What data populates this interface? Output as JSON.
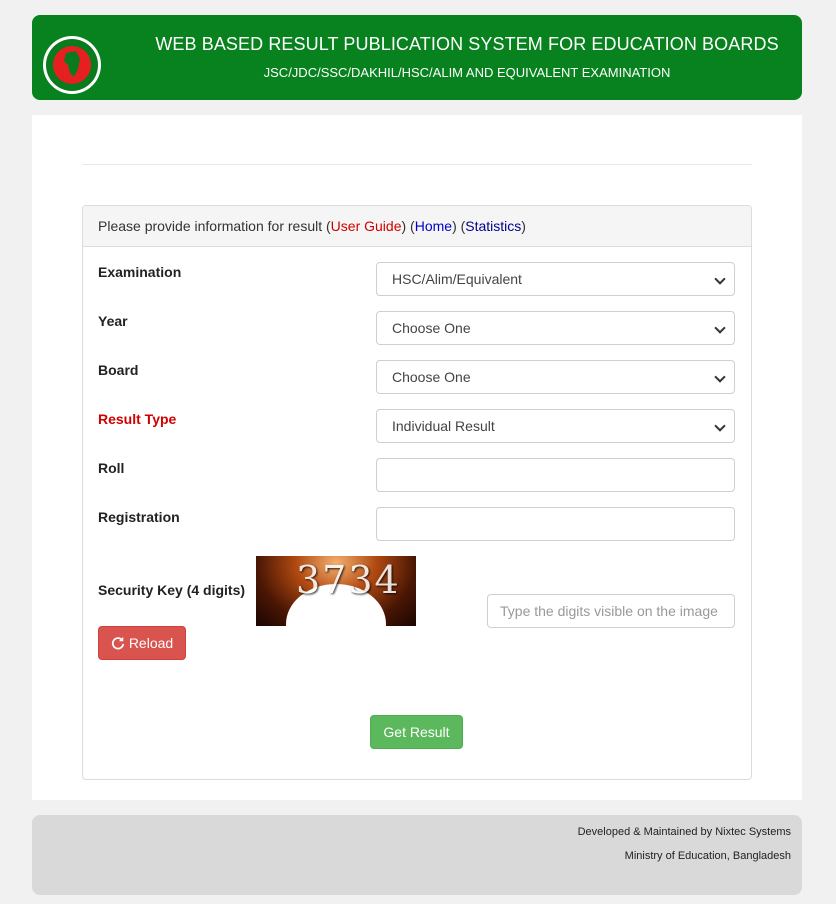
{
  "header": {
    "title": "WEB BASED RESULT PUBLICATION SYSTEM FOR EDUCATION BOARDS",
    "subtitle": "JSC/JDC/SSC/DAKHIL/HSC/ALIM AND EQUIVALENT EXAMINATION",
    "logo_icon": "bangladesh-government-seal-icon"
  },
  "panel": {
    "heading_prefix": "Please provide information for result",
    "link_user_guide": "User Guide",
    "link_home": "Home",
    "link_statistics": "Statistics"
  },
  "form": {
    "examination": {
      "label": "Examination",
      "value": "HSC/Alim/Equivalent"
    },
    "year": {
      "label": "Year",
      "value": "Choose One"
    },
    "board": {
      "label": "Board",
      "value": "Choose One"
    },
    "result_type": {
      "label": "Result Type",
      "value": "Individual Result"
    },
    "roll": {
      "label": "Roll",
      "value": ""
    },
    "registration": {
      "label": "Registration",
      "value": ""
    },
    "security": {
      "label": "Security Key (4 digits)",
      "captcha_text": "3734",
      "placeholder": "Type the digits visible on the image"
    },
    "reload_label": "Reload",
    "submit_label": "Get Result"
  },
  "footer": {
    "line1": "Developed & Maintained by Nixtec Systems",
    "line2": "Ministry of Education, Bangladesh"
  },
  "colors": {
    "header_green": "#08821e",
    "reload_red": "#d9534f",
    "submit_green": "#5cb85c",
    "required_red": "#d10000"
  }
}
